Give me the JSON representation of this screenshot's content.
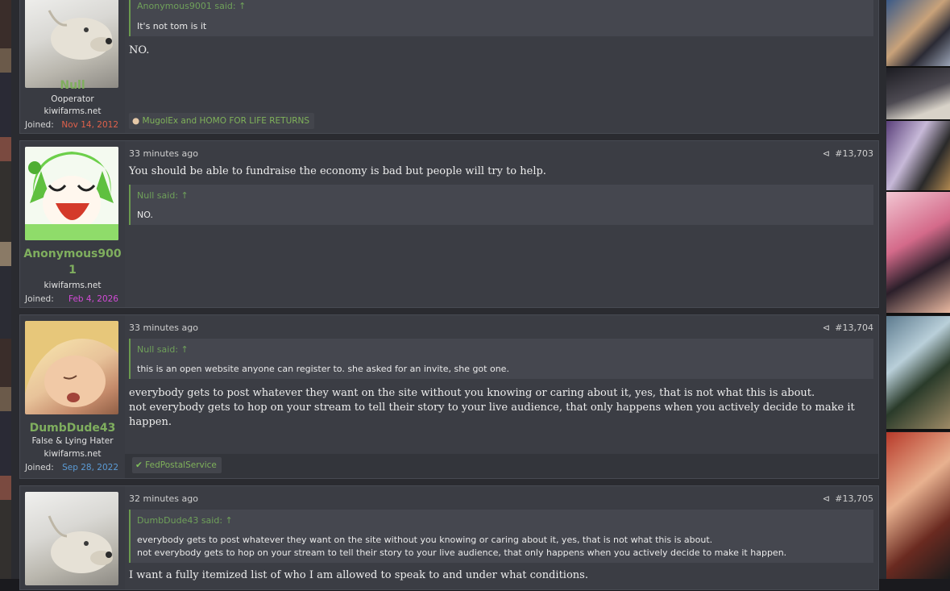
{
  "site": "kiwifarms.net",
  "posts": [
    {
      "username": "Null",
      "user_title": "Ooperator",
      "site": "kiwifarms.net",
      "joined_label": "Joined:",
      "joined_date": "Nov 14, 2012",
      "joined_color": "#e0614b",
      "quote": {
        "author": "Anonymous9001 said:",
        "text": "It's not tom is it"
      },
      "body": "NO.",
      "reaction": "MugolEx and HOMO FOR LIFE RETURNS"
    },
    {
      "username": "Anonymous900",
      "username_line2": "1",
      "site": "kiwifarms.net",
      "joined_label": "Joined:",
      "joined_date": "Feb 4, 2026",
      "joined_color": "#d24bd6",
      "time": "33 minutes ago",
      "number": "#13,703",
      "body": "You should be able to fundraise the economy is bad but people will try to help.",
      "quote": {
        "author": "Null said:",
        "text": "NO."
      }
    },
    {
      "username": "DumbDude43",
      "user_title": "False & Lying Hater",
      "site": "kiwifarms.net",
      "joined_label": "Joined:",
      "joined_date": "Sep 28, 2022",
      "joined_color": "#5b9bd5",
      "time": "33 minutes ago",
      "number": "#13,704",
      "quote": {
        "author": "Null said:",
        "text": "this is an open website anyone can register to. she asked for an invite, she got one."
      },
      "body_lines": [
        "everybody gets to post whatever they want on the site without you knowing or caring about it, yes, that is not what this is about.",
        "not everybody gets to hop on your stream to tell their story to your live audience, that only happens when you actively decide to make it happen."
      ],
      "reaction": "FedPostalService"
    },
    {
      "time": "32 minutes ago",
      "number": "#13,705",
      "quote": {
        "author": "DumbDude43 said:",
        "lines": [
          "everybody gets to post whatever they want on the site without you knowing or caring about it, yes, that is not what this is about.",
          "not everybody gets to hop on your stream to tell their story to your live audience, that only happens when you actively decide to make it happen."
        ]
      },
      "body": "I want a fully itemized list of who I am allowed to speak to and under what conditions."
    }
  ],
  "colors": {
    "username_green": "#7fae5e",
    "quote_green": "#6fa05a",
    "post_bg": "#3b3d44"
  },
  "icons": {
    "share": "share-icon",
    "arrow_up": "arrow-up-circle-icon",
    "check": "check-circle-icon"
  }
}
